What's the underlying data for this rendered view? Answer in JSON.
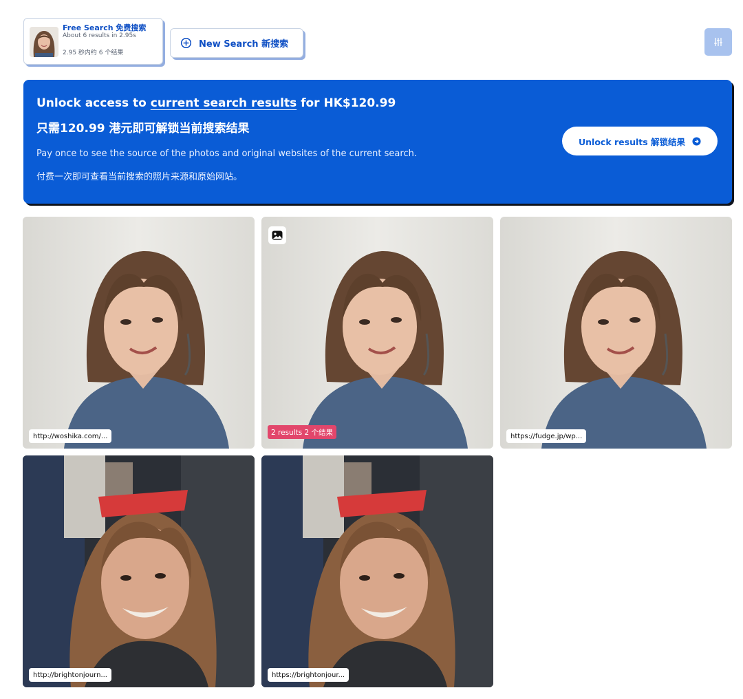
{
  "search_card": {
    "title": "Free Search 免费搜索",
    "stats_en": "About 6 results in 2.95s",
    "stats_zh": "2.95 秒内约 6 个结果"
  },
  "new_search": {
    "label": "New Search 新搜索"
  },
  "banner": {
    "line1_prefix": "Unlock access to ",
    "line1_link": "current search results",
    "line1_suffix": " for HK$120.99",
    "line2": "只需120.99 港元即可解锁当前搜索结果",
    "line3": "Pay once to see the source of the photos and original websites of the current search.",
    "line4": "付费一次即可查看当前搜索的照片来源和原始网站。",
    "unlock_label": "Unlock results 解锁结果"
  },
  "results": [
    {
      "url": "http://woshika.com/..."
    },
    {
      "count": "2 results 2 个结果"
    },
    {
      "url": "https://fudge.jp/wp..."
    },
    {
      "url": "http://brightonjourn..."
    },
    {
      "url": "https://brightonjour..."
    }
  ],
  "colors": {
    "accent": "#0e4fc4",
    "banner": "#0a5cd6",
    "count_badge": "#e2466b",
    "filter_button": "#a8c2ee"
  },
  "icons": {
    "new_search": "plus-circle-icon",
    "filter": "sliders-icon",
    "unlock": "arrow-circle-right-icon",
    "multi_result": "image-gallery-icon"
  }
}
